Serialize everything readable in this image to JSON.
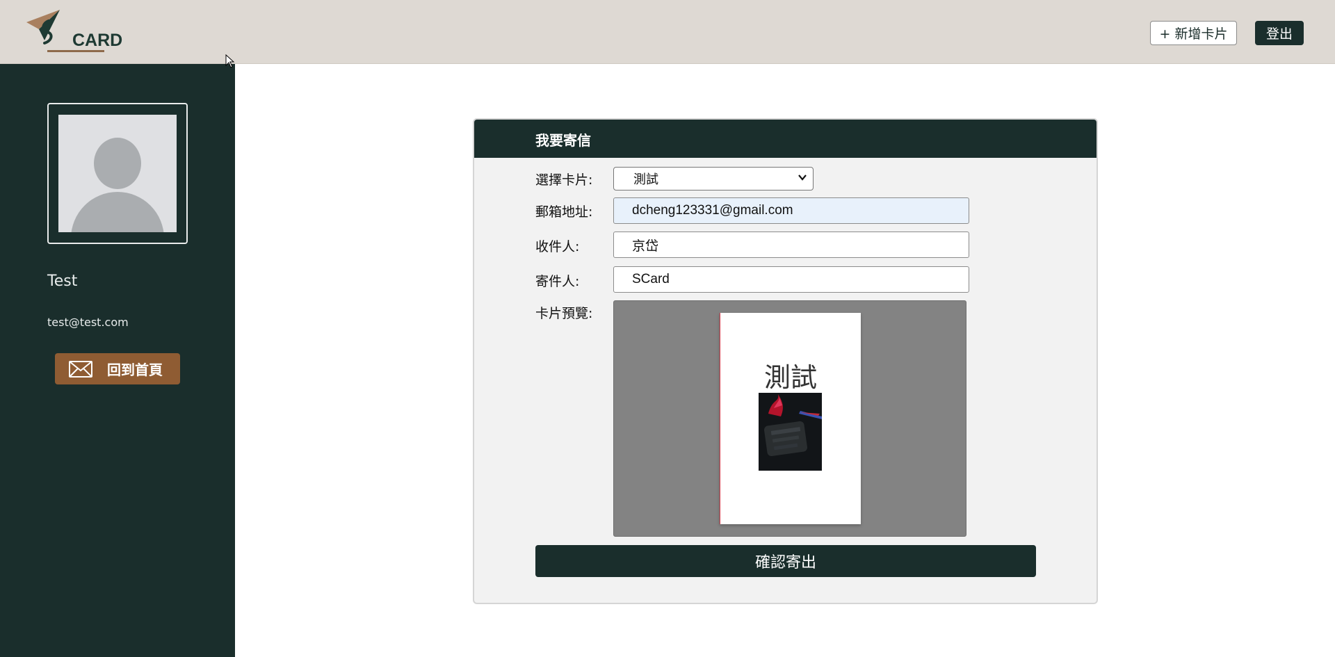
{
  "header": {
    "logo_text": "CARD",
    "add_card_label": "+ 新增卡片",
    "logout_label": "登出"
  },
  "sidebar": {
    "user_name": "Test",
    "user_email": "test@test.com",
    "home_button_label": "回到首頁"
  },
  "form": {
    "title": "我要寄信",
    "select_card_label": "選擇卡片:",
    "select_card_value": "測試",
    "email_label": "郵箱地址:",
    "email_value": "dcheng123331@gmail.com",
    "recipient_label": "收件人:",
    "recipient_value": "京岱",
    "sender_label": "寄件人:",
    "sender_value": "SCard",
    "preview_label": "卡片預覽:",
    "preview_card_title": "測試",
    "submit_label": "確認寄出"
  },
  "colors": {
    "header_bg": "#ded9d3",
    "sidebar_bg": "#1a2e2c",
    "accent_brown": "#8f5c33",
    "autofill_bg": "#e8f1fb"
  },
  "icons": {
    "logo": "scard-paper-plane-logo",
    "home_button": "mail-icon",
    "select": "chevron-down-icon"
  }
}
